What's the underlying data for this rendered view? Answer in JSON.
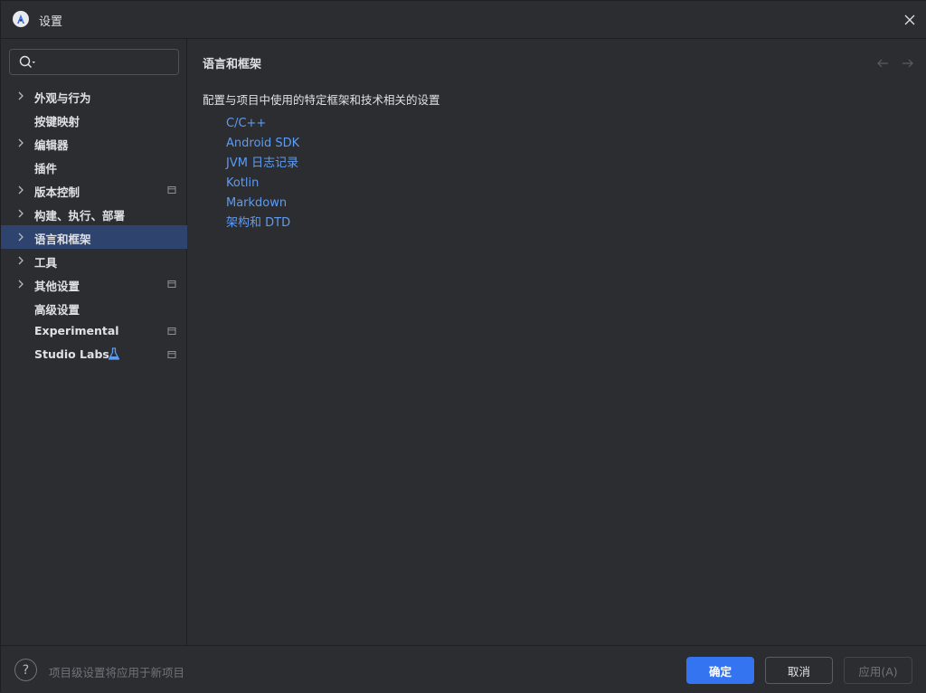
{
  "window": {
    "title": "设置",
    "app_icon": "android-studio-icon",
    "close_icon": "close-icon"
  },
  "search": {
    "value": "",
    "placeholder": "",
    "icon": "search-icon"
  },
  "sidebar": {
    "items": [
      {
        "label": "外观与行为",
        "expandable": true,
        "scope_icon": false
      },
      {
        "label": "按键映射",
        "expandable": false,
        "scope_icon": false
      },
      {
        "label": "编辑器",
        "expandable": true,
        "scope_icon": false
      },
      {
        "label": "插件",
        "expandable": false,
        "scope_icon": false
      },
      {
        "label": "版本控制",
        "expandable": true,
        "scope_icon": true
      },
      {
        "label": "构建、执行、部署",
        "expandable": true,
        "scope_icon": false
      },
      {
        "label": "语言和框架",
        "expandable": true,
        "scope_icon": false,
        "selected": true
      },
      {
        "label": "工具",
        "expandable": true,
        "scope_icon": false
      },
      {
        "label": "其他设置",
        "expandable": true,
        "scope_icon": true
      },
      {
        "label": "高级设置",
        "expandable": false,
        "scope_icon": false
      },
      {
        "label": "Experimental",
        "expandable": false,
        "scope_icon": true
      },
      {
        "label": "Studio Labs",
        "expandable": false,
        "scope_icon": true,
        "badge_icon": "flask-icon"
      }
    ]
  },
  "main": {
    "title": "语言和框架",
    "description": "配置与项目中使用的特定框架和技术相关的设置",
    "links": [
      "C/C++",
      "Android SDK",
      "JVM 日志记录",
      "Kotlin",
      "Markdown",
      "架构和 DTD"
    ]
  },
  "footer": {
    "help_label": "?",
    "note": "项目级设置将应用于新项目",
    "ok_label": "确定",
    "cancel_label": "取消",
    "apply_label": "应用(A)"
  },
  "colors": {
    "background": "#2b2d30",
    "selection": "#2e436e",
    "link": "#5e9cf3",
    "primary_button": "#3574f0"
  }
}
